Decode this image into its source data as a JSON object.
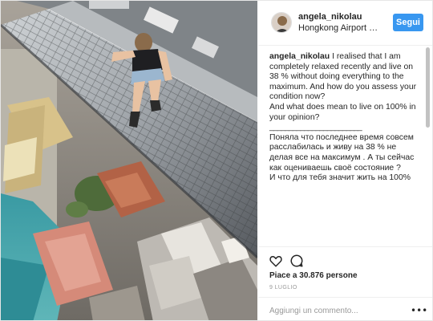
{
  "post": {
    "username": "angela_nikolau",
    "location": "Hongkong Airport Departures",
    "follow_label": "Segui",
    "caption": {
      "user": "angela_nikolau",
      "text": "I realised that I am completely relaxed recently and live on 38 % without doing everything to the maximum. And how do you assess your condition now?\nAnd what does mean to live on 100% in your opinion?",
      "divider": "________________________",
      "text_ru": "Поняла что последнее время совсем расслабилась и живу на 38 % не делая все на максимум . А ты сейчас как оцениваешь своё состояние ?\nИ что для тебя значит жить на 100%"
    },
    "likes_label": "Piace a 30.876 persone",
    "date": "9 LUGLIO",
    "comment_placeholder": "Aggiungi un commento...",
    "icons": {
      "like": "heart-icon",
      "comment": "comment-icon",
      "more": "more-options-icon"
    }
  }
}
